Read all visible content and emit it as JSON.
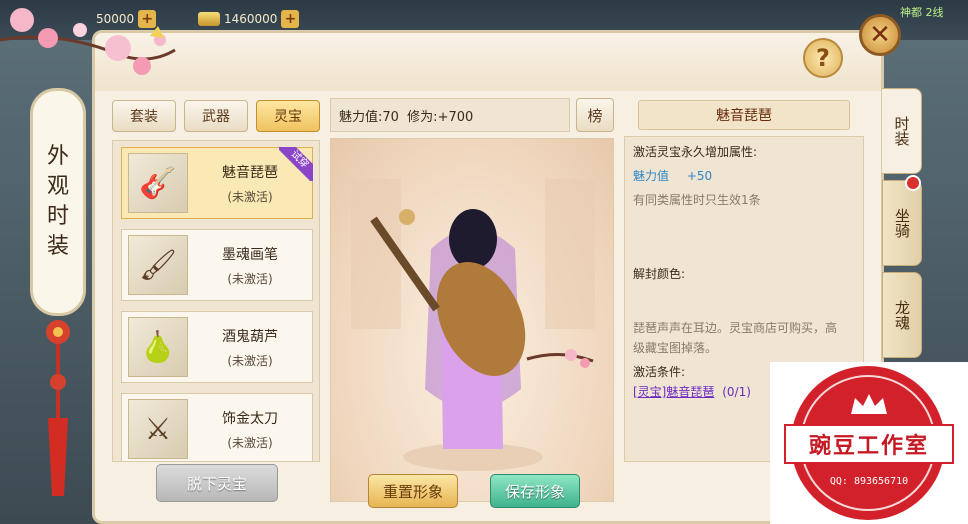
{
  "hud": {
    "currency_1": "50000",
    "currency_2": "1460000",
    "map_label": "神都 2线"
  },
  "panel": {
    "title_chars": [
      "外",
      "观",
      "时",
      "装"
    ],
    "help_label": "?",
    "close_label": "✕"
  },
  "category_tabs": [
    {
      "label": "套装",
      "active": false
    },
    {
      "label": "武器",
      "active": false
    },
    {
      "label": "灵宝",
      "active": true
    }
  ],
  "items": [
    {
      "name": "魅音琵琶",
      "state": "(未激活)",
      "ribbon": "试穿",
      "icon": "pipa-icon",
      "glyph": "🎸"
    },
    {
      "name": "墨魂画笔",
      "state": "(未激活)",
      "ribbon": "",
      "icon": "brush-icon",
      "glyph": "🖌"
    },
    {
      "name": "酒鬼葫芦",
      "state": "(未激活)",
      "ribbon": "",
      "icon": "gourd-icon",
      "glyph": "🍐"
    },
    {
      "name": "饰金太刀",
      "state": "(未激活)",
      "ribbon": "",
      "icon": "sword-icon",
      "glyph": "⚔"
    }
  ],
  "unequip_label": "脱下灵宝",
  "stats": {
    "text": "魅力值:70  修为:+700"
  },
  "rank_label": "榜",
  "stage": {
    "reset_label": "重置形象",
    "save_label": "保存形象"
  },
  "info": {
    "title": "魅音琵琶",
    "activate_heading": "激活灵宝永久增加属性:",
    "attr_name": "魅力值",
    "attr_value": "+50",
    "note": "有同类属性时只生效1条",
    "unlock_heading": "解封颜色:",
    "desc_line1": "琵琶声声在耳边。灵宝商店可购买，高",
    "desc_line2": "级藏宝图掉落。",
    "condition_heading": "激活条件:",
    "condition_link": "[灵宝]魅音琵琶",
    "condition_count": "(0/1)"
  },
  "side_tabs": [
    {
      "label": "时装",
      "active": true,
      "badge": false
    },
    {
      "label": "坐骑",
      "active": false,
      "badge": true
    },
    {
      "label": "龙魂",
      "active": false,
      "badge": false
    }
  ],
  "watermark": {
    "title": "豌豆工作室",
    "qq": "QQ: 893656710"
  },
  "colors": {
    "panel_bg": "#f7f0e2",
    "active_tab": "#f0c25f",
    "save_button": "#3fb28d",
    "stamp_red": "#d3212b"
  }
}
